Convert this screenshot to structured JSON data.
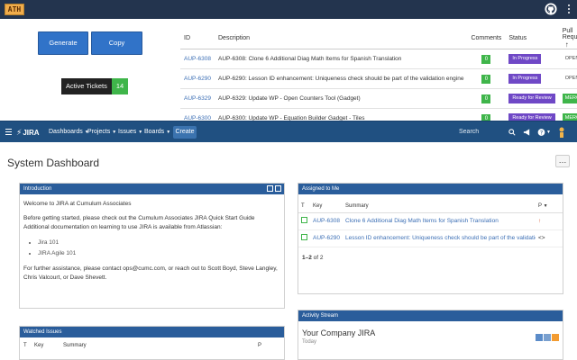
{
  "ath": {
    "logo": "ATH",
    "generate_label": "Generate Issues",
    "copy_label": "Copy Description",
    "active_tickets_label": "Active Tickets",
    "active_tickets_count": "14",
    "table": {
      "headers": [
        "ID",
        "Description",
        "Comments",
        "Status",
        "Pull Request"
      ],
      "rows": [
        {
          "id": "AUP-6308",
          "desc": "AUP-6308: Clone 6 Additional Diag Math Items for Spanish Translation",
          "comments": "0",
          "status": "In Progress",
          "pr": "OPEN"
        },
        {
          "id": "AUP-6290",
          "desc": "AUP-6290: Lesson ID enhancement: Uniqueness check should be part of the validation engine",
          "comments": "0",
          "status": "In Progress",
          "pr": "OPEN"
        },
        {
          "id": "AUP-6329",
          "desc": "AUP-6329: Update WP - Open Counters Tool (Gadget)",
          "comments": "0",
          "status": "Ready for Review",
          "pr": "MERGED"
        },
        {
          "id": "AUP-6300",
          "desc": "AUP-6300: Update WP - Equation Builder Gadget - Tiles",
          "comments": "0",
          "status": "Ready for Review",
          "pr": "MERGED"
        }
      ]
    }
  },
  "jira": {
    "logo": "JIRA",
    "nav": [
      "Dashboards",
      "Projects",
      "Issues",
      "Boards"
    ],
    "create_label": "Create",
    "search_placeholder": "Search"
  },
  "dashboard": {
    "title": "System Dashboard",
    "more_label": "…",
    "intro": {
      "header": "Introduction",
      "welcome": "Welcome to JIRA at Cumulum Associates",
      "line1": "Before getting started, please check out the Cumulum Associates JIRA Quick Start Guide",
      "line2": "Additional documentation on learning to use JIRA is available from Atlassian:",
      "links": [
        "Jira 101",
        "JIRA Agile 101"
      ],
      "footer": "For further assistance, please contact ops@cumc.com, or reach out to Scott Boyd, Steve Langley, Chris Valcourt, or Dave Shevett."
    },
    "watched": {
      "header": "Watched Issues",
      "columns": [
        "T",
        "Key",
        "Summary",
        "P"
      ]
    },
    "assigned": {
      "header": "Assigned to Me",
      "columns": [
        "T",
        "Key",
        "Summary",
        "P"
      ],
      "rows": [
        {
          "key": "AUP-6308",
          "summary": "Clone 6 Additional Diag Math Items for Spanish Translation",
          "prio": "↑"
        },
        {
          "key": "AUP-6290",
          "summary": "Lesson ID enhancement: Uniqueness check should be part of the validation engine",
          "prio": "<>"
        }
      ],
      "pager_range": "1–2",
      "pager_of": "of 2"
    },
    "activity": {
      "header": "Activity Stream",
      "title": "Your Company JIRA",
      "sub": "Today"
    }
  },
  "colors": {
    "ath_bar": "#23344e",
    "jira_bar": "#205081",
    "gadget_header": "#2a5d9b",
    "button_blue": "#3173c8",
    "success_green": "#3fb54a",
    "status_purple": "#6f48c6"
  }
}
